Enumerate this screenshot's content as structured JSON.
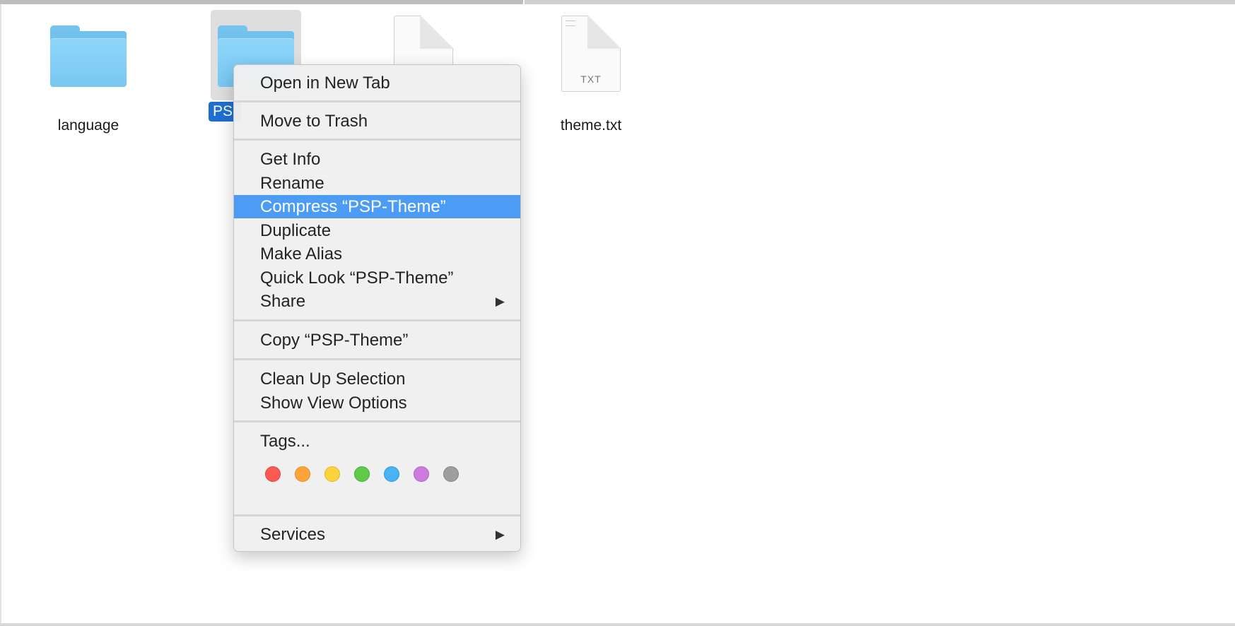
{
  "finder": {
    "items": [
      {
        "label": "language",
        "type": "folder"
      },
      {
        "label": "PS",
        "type": "folder",
        "selected": true
      },
      {
        "label": "",
        "type": "document"
      },
      {
        "label": "theme.txt",
        "type": "document",
        "ext": "TXT"
      }
    ]
  },
  "context_menu": {
    "open_new_tab": "Open in New Tab",
    "move_to_trash": "Move to Trash",
    "get_info": "Get Info",
    "rename": "Rename",
    "compress": "Compress “PSP-Theme”",
    "duplicate": "Duplicate",
    "make_alias": "Make Alias",
    "quick_look": "Quick Look “PSP-Theme”",
    "share": "Share",
    "copy": "Copy “PSP-Theme”",
    "clean_up": "Clean Up Selection",
    "show_view_options": "Show View Options",
    "tags": "Tags...",
    "services": "Services",
    "submenu_arrow": "▶",
    "tag_colors": [
      "#fb5a52",
      "#fda43a",
      "#fdd33c",
      "#5fc94a",
      "#48b3f5",
      "#cd7bdf",
      "#9e9e9e"
    ],
    "tag_borders": [
      "#e0433c",
      "#e58a23",
      "#e3b624",
      "#46ad33",
      "#2e97d8",
      "#b060c2",
      "#838383"
    ]
  },
  "colors": {
    "highlight": "#4c9cf6",
    "selection_label": "#1f6fd0",
    "folder": "#8fd5fa"
  }
}
